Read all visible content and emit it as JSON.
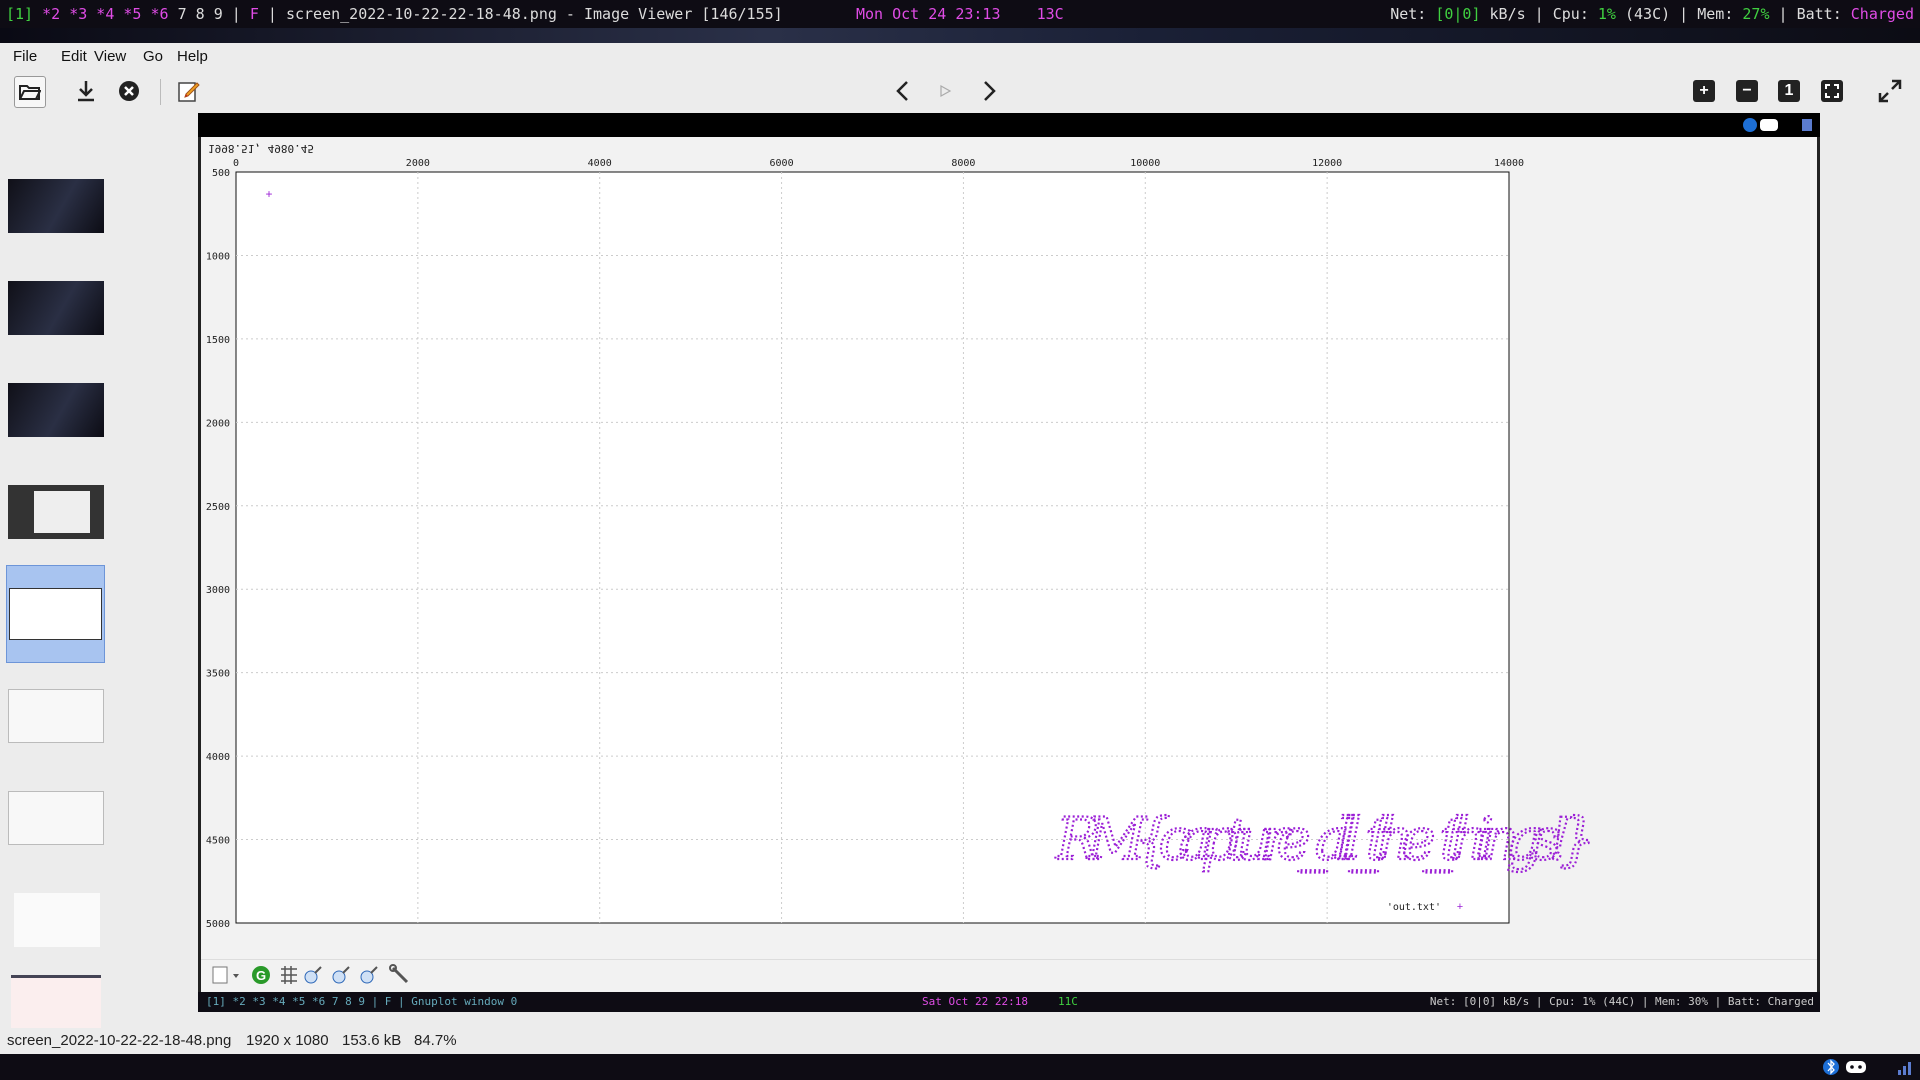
{
  "topbar": {
    "workspace_active": "[1]",
    "workspaces_marked": "*2 *3 *4 *5 *6",
    "workspaces_plain": "7 8 9",
    "layout": "F",
    "window_title": "screen_2022-10-22-22-18-48.png - Image Viewer [146/155]",
    "datetime": "Mon Oct 24 23:13",
    "temp": "13C",
    "net_label": "Net:",
    "net_value": "[0|0]",
    "net_unit": "kB/s",
    "cpu_label": "Cpu:",
    "cpu_value": "1%",
    "cpu_temp": "(43C)",
    "mem_label": "Mem:",
    "mem_value": "27%",
    "batt_label": "Batt:",
    "batt_value": "Charged"
  },
  "menu": {
    "file": "File",
    "edit": "Edit",
    "view": "View",
    "go": "Go",
    "help": "Help"
  },
  "toolbar": {
    "icons": [
      "folder-open-icon",
      "download-icon",
      "close-circle-icon",
      "edit-icon",
      "chevron-left-icon",
      "play-icon",
      "chevron-right-icon",
      "zoom-in-icon",
      "zoom-out-icon",
      "actual-size-icon",
      "fit-icon",
      "fullscreen-icon"
    ],
    "actual_size_label": "1"
  },
  "plot": {
    "corner_readout": "1998.51, 4980.45",
    "x_ticks": [
      "0",
      "2000",
      "4000",
      "6000",
      "8000",
      "10000",
      "12000",
      "14000"
    ],
    "y_ticks": [
      "500",
      "1000",
      "1500",
      "2000",
      "2500",
      "3000",
      "3500",
      "4000",
      "4500",
      "5000"
    ],
    "legend_label": "'out.txt'",
    "legend_marker": "+",
    "handwriting": "RM{capture_all_the_things!}",
    "bottom_bar_left": "[1] *2 *3 *4 *5 *6 7 8 9 | F | Gnuplot window 0",
    "bottom_bar_center": "Sat Oct 22 22:18",
    "bottom_bar_temp": "11C",
    "bottom_bar_right": "Net: [0|0] kB/s | Cpu: 1% (44C) | Mem: 30% | Batt: Charged"
  },
  "status": {
    "filename": "screen_2022-10-22-22-18-48.png",
    "dimensions": "1920 x 1080",
    "size": "153.6 kB",
    "zoom": "84.7%"
  },
  "colors": {
    "plot": "#9b1fd6",
    "accent_green": "#40d040",
    "accent_magenta": "#e04ce6",
    "selection": "#a8c4f0"
  }
}
